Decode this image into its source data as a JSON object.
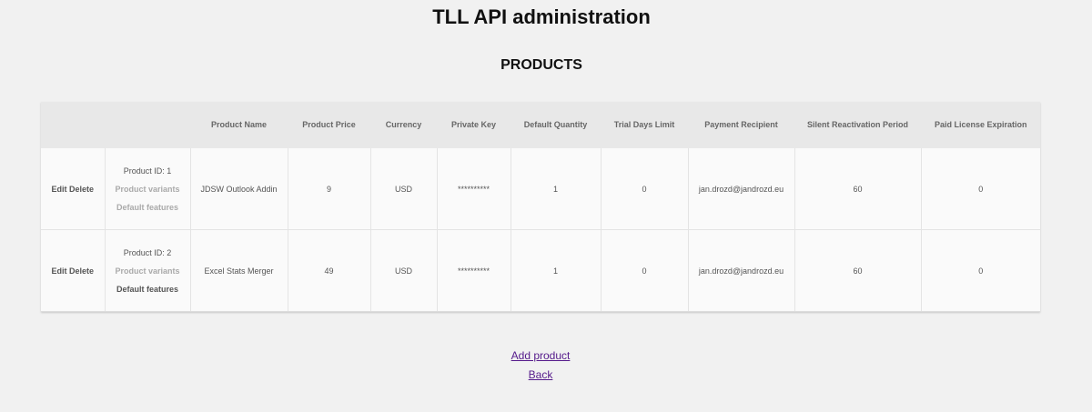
{
  "page": {
    "title": "TLL API administration",
    "section_title": "PRODUCTS"
  },
  "table": {
    "headers": [
      "",
      "",
      "Product Name",
      "Product Price",
      "Currency",
      "Private Key",
      "Default Quantity",
      "Trial Days Limit",
      "Payment Recipient",
      "Silent Reactivation Period",
      "Paid License Expiration"
    ],
    "rows": [
      {
        "edit_label": "Edit",
        "delete_label": "Delete",
        "product_id": "Product ID: 1",
        "variants_label": "Product variants",
        "features_label": "Default features",
        "product_name": "JDSW Outlook Addin",
        "product_price": "9",
        "currency": "USD",
        "private_key": "**********",
        "default_quantity": "1",
        "trial_days_limit": "0",
        "payment_recipient": "jan.drozd@jandrozd.eu",
        "silent_reactivation_period": "60",
        "paid_license_expiration": "0"
      },
      {
        "edit_label": "Edit",
        "delete_label": "Delete",
        "product_id": "Product ID: 2",
        "variants_label": "Product variants",
        "features_label": "Default features",
        "product_name": "Excel Stats Merger",
        "product_price": "49",
        "currency": "USD",
        "private_key": "**********",
        "default_quantity": "1",
        "trial_days_limit": "0",
        "payment_recipient": "jan.drozd@jandrozd.eu",
        "silent_reactivation_period": "60",
        "paid_license_expiration": "0"
      }
    ]
  },
  "links": {
    "add_product": "Add product",
    "back": "Back"
  },
  "colors": {
    "background": "#f1f1f1",
    "header_bg": "#e8e8e8",
    "link": "#551a8b"
  }
}
